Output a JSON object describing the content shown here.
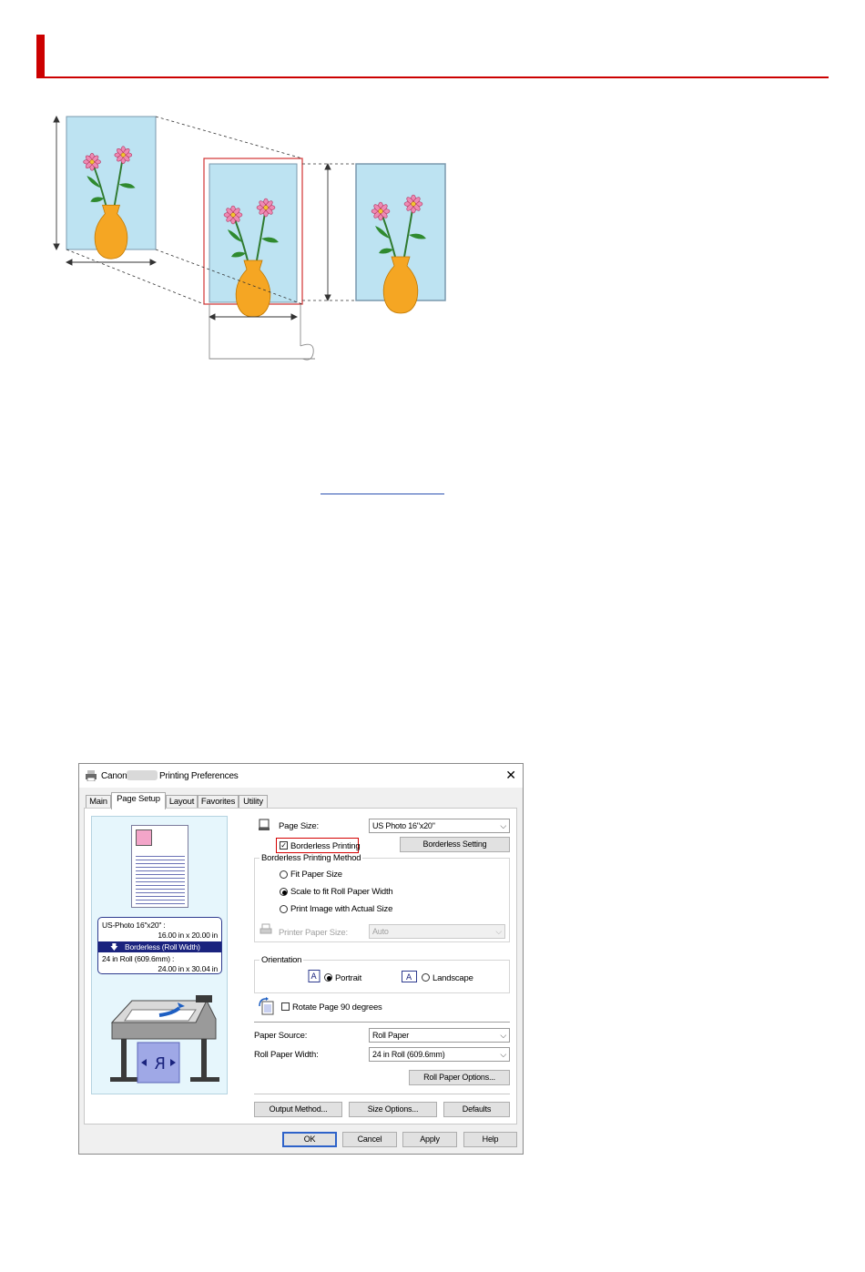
{
  "dialog": {
    "title_prefix": "Canon",
    "title_suffix": "Printing Preferences",
    "close_glyph": "✕",
    "tabs": [
      {
        "label": "Main"
      },
      {
        "label": "Page Setup"
      },
      {
        "label": "Layout"
      },
      {
        "label": "Favorites"
      },
      {
        "label": "Utility"
      }
    ],
    "preview": {
      "line1": "US-Photo 16\"x20\" :",
      "line2": "16.00 in x 20.00 in",
      "line3": "Borderless (Roll Width)",
      "line4": "24 in Roll (609.6mm) :",
      "line5": "24.00 in x 30.04 in"
    },
    "page_size": {
      "label": "Page Size:",
      "value": "US Photo 16\"x20\""
    },
    "borderless_printing": {
      "label": "Borderless Printing",
      "checked": true
    },
    "borderless_setting_button": "Borderless Setting",
    "method_group": {
      "label": "Borderless Printing Method",
      "options": [
        "Fit Paper Size",
        "Scale to fit Roll Paper Width",
        "Print Image with Actual Size"
      ],
      "selected": 1
    },
    "printer_paper_size": {
      "label": "Printer Paper Size:",
      "value": "Auto"
    },
    "orientation": {
      "label": "Orientation",
      "portrait": "Portrait",
      "landscape": "Landscape",
      "selected": "Portrait"
    },
    "rotate": {
      "label": "Rotate Page 90 degrees",
      "checked": false
    },
    "paper_source": {
      "label": "Paper Source:",
      "value": "Roll Paper"
    },
    "roll_paper_width": {
      "label": "Roll Paper Width:",
      "value": "24 in Roll (609.6mm)"
    },
    "roll_paper_options_button": "Roll Paper Options...",
    "output_method_button": "Output Method...",
    "size_options_button": "Size Options...",
    "defaults_button": "Defaults",
    "ok_button": "OK",
    "cancel_button": "Cancel",
    "apply_button": "Apply",
    "help_button": "Help"
  }
}
